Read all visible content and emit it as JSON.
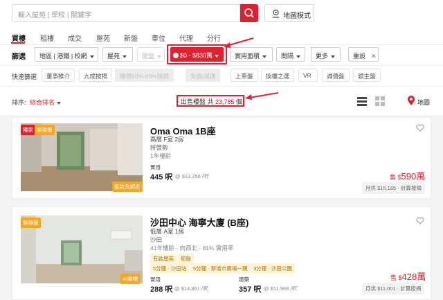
{
  "search": {
    "placeholder": "輸入屋苑 | 學校 | 關鍵字"
  },
  "map_mode": {
    "label": "地圖模式"
  },
  "tabs": [
    "買樓",
    "租樓",
    "成交",
    "屋苑",
    "新盤",
    "車位",
    "代理",
    "分行"
  ],
  "filters": {
    "label": "篩選",
    "district": "地區 | 港鐵 | 校網",
    "estate": "屋苑",
    "type": "開盤",
    "price": "$0 - $830萬",
    "area": "實用面積",
    "rooms": "間隔",
    "more": "更多",
    "reset": "重設",
    "reset_icon": "✕"
  },
  "quick_filters": {
    "label": "快速篩選",
    "items": [
      "董事推介",
      "九成按揭",
      "樓價50%-80%按揭",
      "免佣/減佣",
      "上車盤",
      "換樓之選",
      "VR",
      "減價盤",
      "銀主盤"
    ]
  },
  "sort": {
    "label": "排序:",
    "value": "綜合排名"
  },
  "result": {
    "prefix": "出售樓盤 共",
    "count": "23,785",
    "suffix": "個"
  },
  "view_map_label": "地圖",
  "listings": [
    {
      "badges": [
        "獨家",
        "睇得盤"
      ],
      "photo_tag": "藍欸及調皮",
      "title": "Oma Oma 1B座",
      "line1": "高層 F室 2房",
      "line2": "將營勢",
      "line3": "1年樓齡",
      "area_label": "實用",
      "area": "445 呎",
      "unit_price": "@ $13,258 /呎",
      "price_prefix": "售 $",
      "price": "590萬",
      "monthly": "月供 $15,165 · 計算按揭",
      "colors": {
        "photo_bg": "#b8b0a2"
      }
    },
    {
      "badges": [
        "睇得盤"
      ],
      "photo_tag": "AI睇樓",
      "title": "沙田中心 海寧大廈 (B座)",
      "line1": "低層 A室 1房",
      "line2": "沙田",
      "line3": "41年樓齡 · 向西北 · 81% 實用率",
      "tags": [
        "有匙屋苑",
        "筍盤"
      ],
      "transport": [
        "5分鐘 · 沙田站",
        "5分鐘 · 新城市廣場一期",
        "3分鐘 · 沙田公園"
      ],
      "area_label": "實用",
      "area": "288 呎",
      "unit_price": "@ $14,861 /呎",
      "area2_label": "建築",
      "area2": "357 呎",
      "unit_price2": "@ $11,988 /呎",
      "price_prefix": "售 $",
      "price": "428萬",
      "monthly": "月供 $11,001 · 計算按揭",
      "colors": {
        "photo_bg": "#bfc6bf"
      }
    }
  ],
  "colors": {
    "accent": "#e0202f",
    "annotation": "#e0202f"
  }
}
